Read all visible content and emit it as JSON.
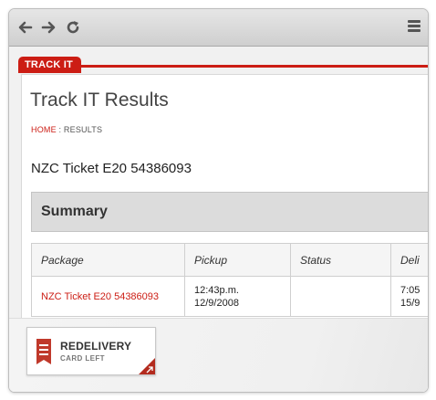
{
  "browser": {
    "icons": [
      "back-arrow-icon",
      "forward-arrow-icon",
      "reload-icon",
      "hamburger-menu-icon"
    ]
  },
  "brand": {
    "tab_label": "TRACK IT",
    "accent_color": "#cc1d14"
  },
  "page": {
    "title": "Track IT Results",
    "breadcrumb_home": "HOME",
    "breadcrumb_sep": ":",
    "breadcrumb_current": "RESULTS",
    "ticket_title": "NZC Ticket E20 54386093"
  },
  "summary": {
    "title": "Summary"
  },
  "table": {
    "columns": [
      "Package",
      "Pickup",
      "Status",
      "Deli"
    ],
    "rows": [
      {
        "package": "NZC Ticket E20 54386093",
        "pickup_time": "12:43p.m.",
        "pickup_date": "12/9/2008",
        "status": "",
        "delivery_time": "7:05",
        "delivery_date": "15/9"
      }
    ]
  },
  "redelivery": {
    "title": "REDELIVERY",
    "subtitle": "CARD LEFT",
    "icon": "document-card-icon",
    "corner_icon": "diagonal-arrow-icon"
  }
}
